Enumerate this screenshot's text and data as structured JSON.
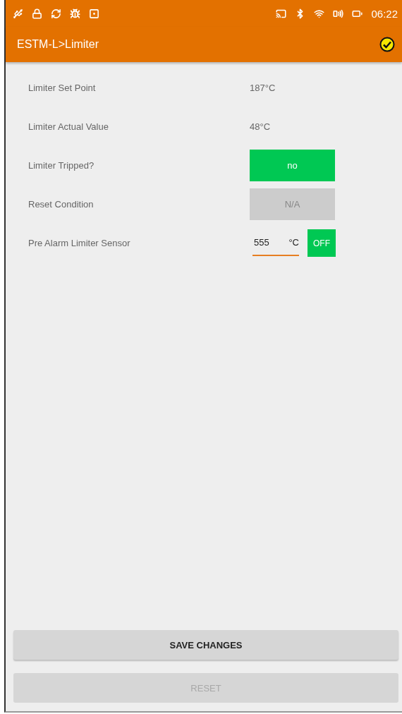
{
  "status_bar": {
    "time": "06:22"
  },
  "app_bar": {
    "title": "ESTM-L>Limiter"
  },
  "rows": [
    {
      "kind": "text",
      "label": "Limiter Set Point",
      "value": "187°C"
    },
    {
      "kind": "text",
      "label": "Limiter Actual Value",
      "value": "48°C"
    },
    {
      "kind": "status",
      "label": "Limiter Tripped?",
      "value": "no",
      "active": true
    },
    {
      "kind": "status",
      "label": "Reset Condition",
      "value": "N/A",
      "active": false
    },
    {
      "kind": "input",
      "label": "Pre Alarm Limiter Sensor",
      "value": "555",
      "unit": "°C",
      "toggle": "OFF"
    }
  ],
  "buttons": [
    {
      "label": "SAVE CHANGES",
      "disabled": false
    },
    {
      "label": "RESET",
      "disabled": true
    }
  ]
}
